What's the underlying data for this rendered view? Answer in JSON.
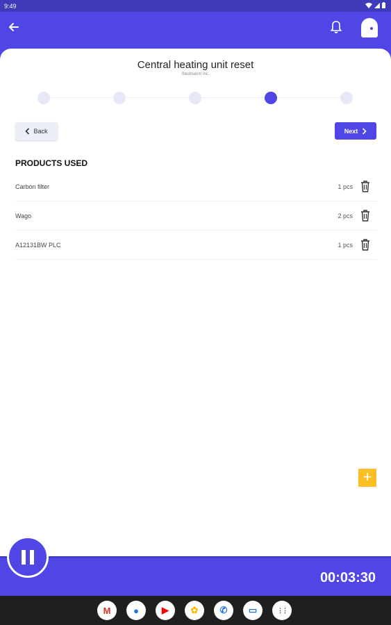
{
  "status_bar": {
    "time": "9:49"
  },
  "app_bar": {
    "back_icon": "arrow-left-icon",
    "bell_icon": "bell-icon",
    "avatar_icon": "ghost-avatar-icon"
  },
  "task": {
    "title": "Central heating unit reset",
    "subtitle": "Stedmanm Inc."
  },
  "stepper": {
    "total_steps": 5,
    "current_step": 4
  },
  "nav_buttons": {
    "back_label": "Back",
    "next_label": "Next"
  },
  "products": {
    "section_title": "PRODUCTS USED",
    "items": [
      {
        "name": "Carbon filter",
        "qty": "1 pcs"
      },
      {
        "name": "Wago",
        "qty": "2 pcs"
      },
      {
        "name": "A12131BW PLC",
        "qty": "1 pcs"
      }
    ]
  },
  "fab": {
    "label": "+"
  },
  "timer": {
    "value": "00:03:30"
  },
  "dock": {
    "apps": [
      {
        "icon": "gmail-icon",
        "glyph": "M",
        "color": "#d93025"
      },
      {
        "icon": "chrome-icon",
        "glyph": "●",
        "color": "#1a73e8"
      },
      {
        "icon": "youtube-icon",
        "glyph": "▶",
        "color": "#ff0000"
      },
      {
        "icon": "photos-icon",
        "glyph": "✿",
        "color": "#fbbc04"
      },
      {
        "icon": "phone-icon",
        "glyph": "✆",
        "color": "#1a73e8"
      },
      {
        "icon": "messages-icon",
        "glyph": "▭",
        "color": "#1a73e8"
      },
      {
        "icon": "app-drawer-icon",
        "glyph": "⋮⋮",
        "color": "#333333"
      }
    ]
  }
}
